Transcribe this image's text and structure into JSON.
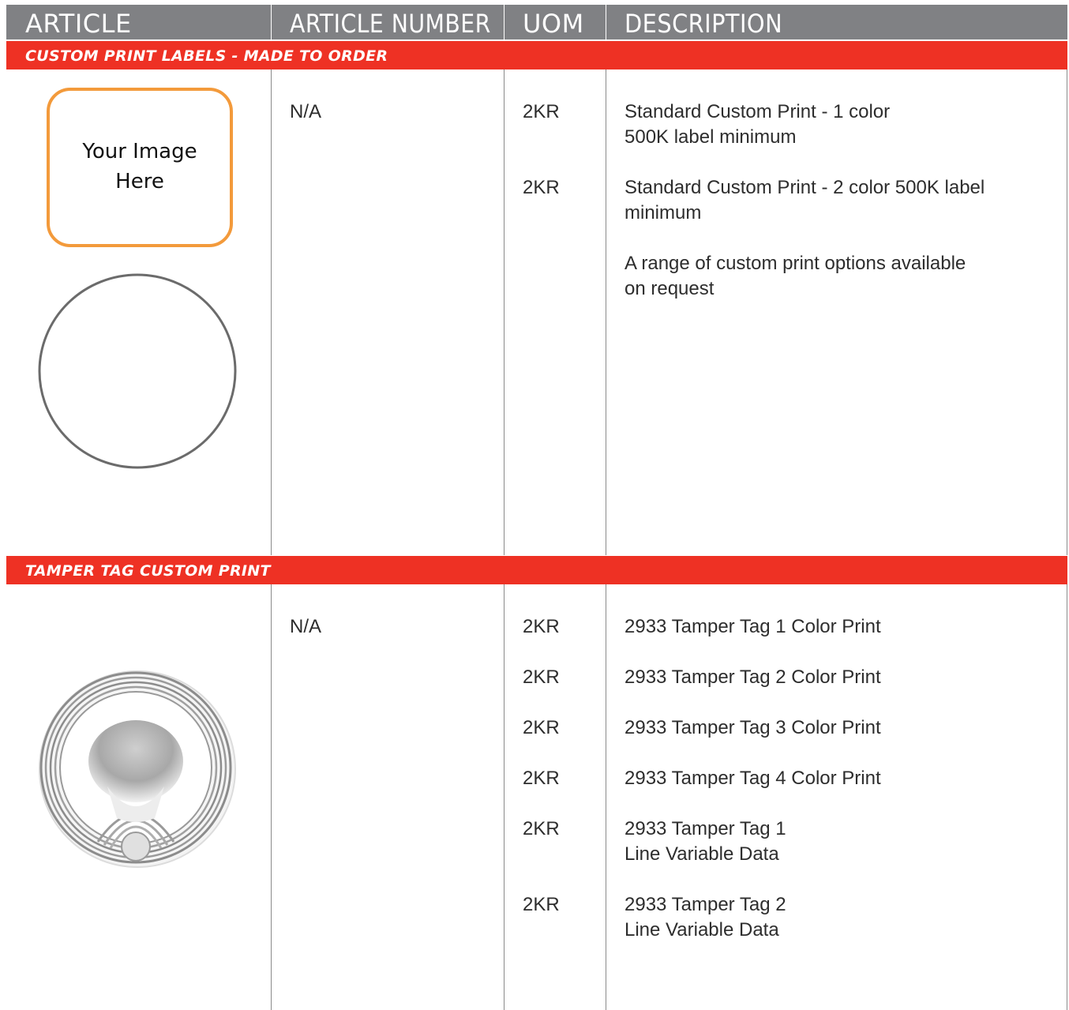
{
  "header": {
    "columns": [
      "ARTICLE",
      "ARTICLE NUMBER",
      "UOM",
      "DESCRIPTION"
    ],
    "background": "#808184"
  },
  "accent_color": "#ee3124",
  "placeholder_color": "#f39a3b",
  "sections": [
    {
      "title": "CUSTOM PRINT LABELS - MADE TO ORDER",
      "placeholder_line1": "Your Image",
      "placeholder_line2": "Here",
      "icons": [
        "image-placeholder-icon",
        "circle-label-icon"
      ],
      "article_number": "N/A",
      "rows": [
        {
          "uom": "2KR",
          "lines": [
            "Standard Custom Print - 1 color",
            "500K label minimum"
          ]
        },
        {
          "uom": "2KR",
          "lines": [
            "Standard Custom Print - 2 color 500K label",
            "minimum"
          ]
        },
        {
          "uom": "",
          "lines": [
            "A range of custom print options available",
            "on request"
          ]
        }
      ]
    },
    {
      "title": "TAMPER TAG CUSTOM PRINT",
      "icons": [
        "rfid-tamper-tag-icon"
      ],
      "article_number": "N/A",
      "rows": [
        {
          "uom": "2KR",
          "lines": [
            "2933 Tamper Tag 1 Color Print"
          ]
        },
        {
          "uom": "2KR",
          "lines": [
            "2933 Tamper Tag 2 Color Print"
          ]
        },
        {
          "uom": "2KR",
          "lines": [
            "2933 Tamper Tag 3 Color Print"
          ]
        },
        {
          "uom": "2KR",
          "lines": [
            "2933 Tamper Tag 4 Color Print"
          ]
        },
        {
          "uom": "2KR",
          "lines": [
            "2933 Tamper Tag 1",
            "Line Variable Data"
          ]
        },
        {
          "uom": "2KR",
          "lines": [
            "2933 Tamper Tag 2",
            "Line Variable Data"
          ]
        }
      ]
    }
  ]
}
